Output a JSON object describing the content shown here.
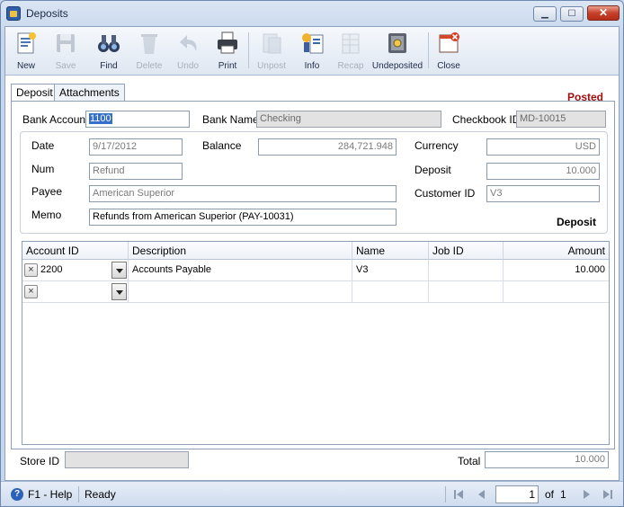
{
  "window": {
    "title": "Deposits",
    "minimize": "▁",
    "maximize": "☐",
    "close": "✕"
  },
  "toolbar": {
    "new": "New",
    "save": "Save",
    "find": "Find",
    "delete": "Delete",
    "undo": "Undo",
    "print": "Print",
    "unpost": "Unpost",
    "info": "Info",
    "recap": "Recap",
    "undeposited": "Undeposited",
    "close": "Close"
  },
  "tabs": {
    "deposit": "Deposit",
    "attachments": "Attachments"
  },
  "status_badge": "Posted",
  "header": {
    "bank_account_label": "Bank Account",
    "bank_account_value": "1100",
    "bank_name_label": "Bank Name",
    "bank_name_value": "Checking",
    "checkbook_id_label": "Checkbook ID",
    "checkbook_id_value": "MD-10015"
  },
  "details": {
    "date_label": "Date",
    "date_value": "9/17/2012",
    "balance_label": "Balance",
    "balance_value": "284,721.948",
    "currency_label": "Currency",
    "currency_value": "USD",
    "num_label": "Num",
    "num_value": "Refund",
    "deposit_label": "Deposit",
    "deposit_value": "10.000",
    "payee_label": "Payee",
    "payee_value": "American Superior",
    "customer_id_label": "Customer ID",
    "customer_id_value": "V3",
    "memo_label": "Memo",
    "memo_value": "Refunds from American Superior (PAY-10031)",
    "type_label": "Deposit"
  },
  "grid": {
    "columns": [
      "Account ID",
      "Description",
      "Name",
      "Job ID",
      "Amount"
    ],
    "rows": [
      {
        "remove": "×",
        "account_id": "2200",
        "description": "Accounts Payable",
        "name": "V3",
        "job_id": "",
        "amount": "10.000"
      },
      {
        "remove": "×",
        "account_id": "",
        "description": "",
        "name": "",
        "job_id": "",
        "amount": ""
      }
    ]
  },
  "footer": {
    "store_id_label": "Store ID",
    "store_id_value": "",
    "total_label": "Total",
    "total_value": "10.000"
  },
  "statusbar": {
    "help": "F1 - Help",
    "help_icon": "?",
    "status": "Ready",
    "page": "1",
    "of_label": "of",
    "total_pages": "1"
  }
}
